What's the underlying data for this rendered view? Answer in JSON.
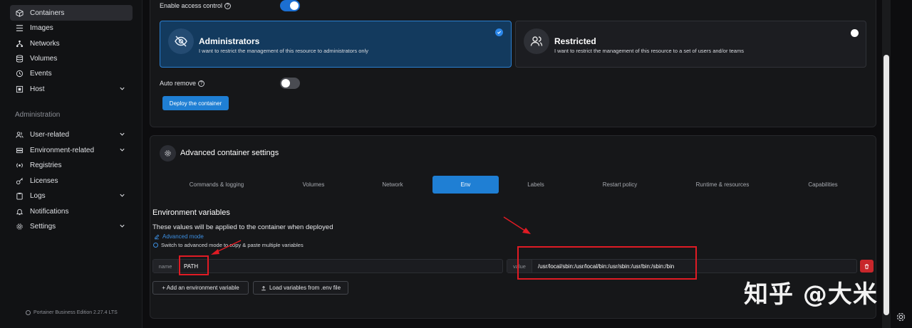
{
  "sidebar": {
    "items": [
      {
        "label": "Containers",
        "icon": "cube-icon"
      },
      {
        "label": "Images",
        "icon": "list-icon"
      },
      {
        "label": "Networks",
        "icon": "network-icon"
      },
      {
        "label": "Volumes",
        "icon": "database-icon"
      },
      {
        "label": "Events",
        "icon": "history-icon"
      },
      {
        "label": "Host",
        "icon": "host-icon"
      }
    ],
    "admin_title": "Administration",
    "admin_items": [
      {
        "label": "User-related",
        "icon": "users-icon"
      },
      {
        "label": "Environment-related",
        "icon": "server-icon"
      },
      {
        "label": "Registries",
        "icon": "radio-icon"
      },
      {
        "label": "Licenses",
        "icon": "key-icon"
      },
      {
        "label": "Logs",
        "icon": "clipboard-icon"
      },
      {
        "label": "Notifications",
        "icon": "bell-icon"
      },
      {
        "label": "Settings",
        "icon": "gear-icon"
      }
    ],
    "footer": "Portainer Business Edition 2.27.4 LTS"
  },
  "access": {
    "enable_label": "Enable access control",
    "enabled": true,
    "admin_card": {
      "title": "Administrators",
      "desc": "I want to restrict the management of this resource to administrators only"
    },
    "restricted_card": {
      "title": "Restricted",
      "desc": "I want to restrict the management of this resource to a set of users and/or teams"
    },
    "auto_remove_label": "Auto remove",
    "auto_remove": false,
    "deploy_label": "Deploy the container"
  },
  "advanced": {
    "title": "Advanced container settings",
    "tabs": [
      "Commands & logging",
      "Volumes",
      "Network",
      "Env",
      "Labels",
      "Restart policy",
      "Runtime & resources",
      "Capabilities"
    ],
    "active_tab": "Env"
  },
  "env": {
    "title": "Environment variables",
    "subtitle": "These values will be applied to the container when deployed",
    "advanced_mode_link": "Advanced mode",
    "hint": "Switch to advanced mode to copy & paste multiple variables",
    "name_addon": "name",
    "name_value": "PATH",
    "value_addon": "value",
    "value_value": "/usr/local/sbin:/usr/local/bin:/usr/sbin:/usr/bin:/sbin:/bin",
    "add_label": "+ Add an environment variable",
    "load_label": "Load variables from .env file"
  },
  "watermark": "知乎 @大米",
  "colors": {
    "accent": "#1f7fd4",
    "danger": "#c8262b",
    "annotation": "#e01b24"
  }
}
